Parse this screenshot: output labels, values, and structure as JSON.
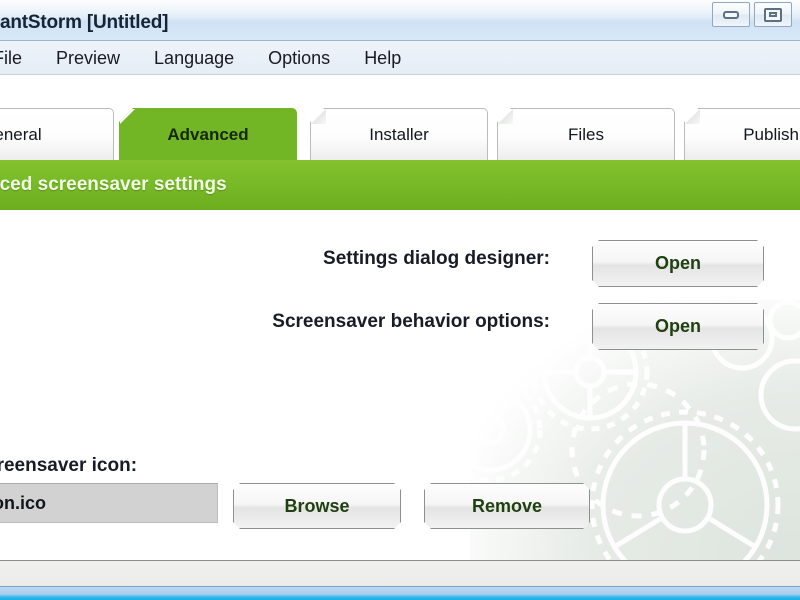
{
  "window": {
    "title": "antStorm [Untitled]",
    "controls": [
      {
        "name": "minimize-button",
        "icon": "minimize-icon"
      },
      {
        "name": "restore-button",
        "icon": "restore-icon"
      }
    ]
  },
  "menubar": {
    "items": [
      {
        "label": "File"
      },
      {
        "label": "Preview"
      },
      {
        "label": "Language"
      },
      {
        "label": "Options"
      },
      {
        "label": "Help"
      }
    ]
  },
  "tabs": [
    {
      "label": "eneral",
      "active": false
    },
    {
      "label": "Advanced",
      "active": true
    },
    {
      "label": "Installer",
      "active": false
    },
    {
      "label": "Files",
      "active": false
    },
    {
      "label": "Publishi",
      "active": false
    }
  ],
  "banner": {
    "text": "nced screensaver settings"
  },
  "main": {
    "rows": [
      {
        "label": "Settings dialog designer:",
        "button": "Open"
      },
      {
        "label": "Screensaver behavior options:",
        "button": "Open"
      }
    ],
    "icon_section": {
      "label": "creensaver icon:",
      "path_value": "on.ico",
      "browse_label": "Browse",
      "remove_label": "Remove"
    }
  },
  "statusbar": {
    "text": ""
  },
  "colors": {
    "accent_green": "#72b626",
    "banner_green": "#78ba27",
    "title_blue": "#cfe2f4",
    "bottom_cyan": "#17b2e6",
    "button_text_green": "#1f4010",
    "field_grey": "#d2d2d2"
  }
}
